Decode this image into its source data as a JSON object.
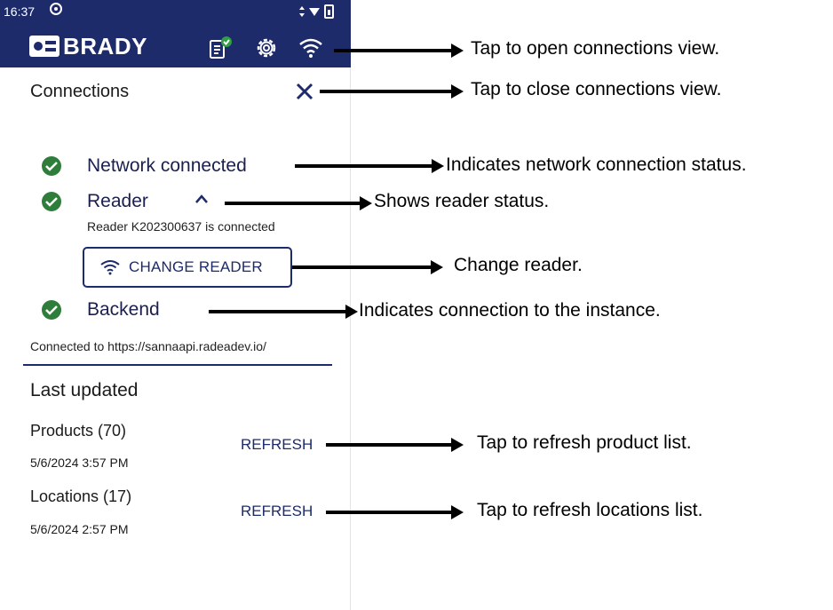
{
  "status_bar": {
    "time": "16:37"
  },
  "app_bar": {
    "brand": "BRADY",
    "icons": [
      "document-check-icon",
      "gear-icon",
      "wifi-icon"
    ],
    "color": "#1d2b6b"
  },
  "panel": {
    "title": "Connections",
    "close_icon": "close-icon",
    "network": {
      "label": "Network connected"
    },
    "reader": {
      "label": "Reader",
      "status": "Reader K202300637 is connected",
      "change_button": "CHANGE READER"
    },
    "backend": {
      "label": "Backend",
      "status": "Connected to https://sannaapi.radeadev.io/"
    },
    "last_updated": {
      "title": "Last updated",
      "items": [
        {
          "label": "Products (70)",
          "date": "5/6/2024 3:57 PM",
          "action": "REFRESH"
        },
        {
          "label": "Locations (17)",
          "date": "5/6/2024 2:57 PM",
          "action": "REFRESH"
        }
      ]
    },
    "status_color": "#2f7d3a"
  },
  "annotations": [
    "Tap to open connections view.",
    "Tap to close connections view.",
    "Indicates network connection status.",
    "Shows reader status.",
    "Change reader.",
    "Indicates connection to the instance.",
    "Tap to refresh product list.",
    "Tap to refresh locations list."
  ]
}
